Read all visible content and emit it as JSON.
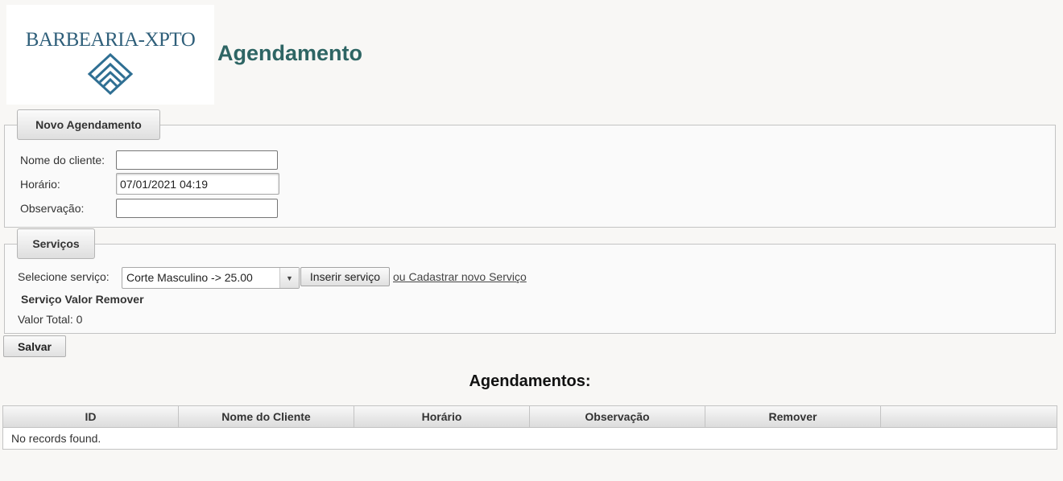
{
  "logo": {
    "text": "BARBEARIA-XPTO",
    "mark_icon": "layered-diamond-logo",
    "color": "#2f5f7a"
  },
  "page_title": "Agendamento",
  "novo_agendamento": {
    "legend": "Novo Agendamento",
    "nome_label": "Nome do cliente:",
    "nome_value": "",
    "horario_label": "Horário:",
    "horario_value": "07/01/2021 04:19",
    "observacao_label": "Observação:",
    "observacao_value": ""
  },
  "servicos": {
    "legend": "Serviços",
    "select_label": "Selecione serviço:",
    "select_value": "Corte Masculino -> 25.00",
    "insert_button": "Inserir serviço",
    "new_service_link": "ou Cadastrar novo Serviço",
    "columns_header": "Serviço Valor Remover",
    "total": "Valor Total: 0"
  },
  "save_button": "Salvar",
  "agendamentos": {
    "title": "Agendamentos:",
    "columns": [
      "ID",
      "Nome do Cliente",
      "Horário",
      "Observação",
      "Remover"
    ],
    "empty_message": "No records found."
  },
  "colors": {
    "title": "#2e6564",
    "background": "#f8f7f5"
  }
}
